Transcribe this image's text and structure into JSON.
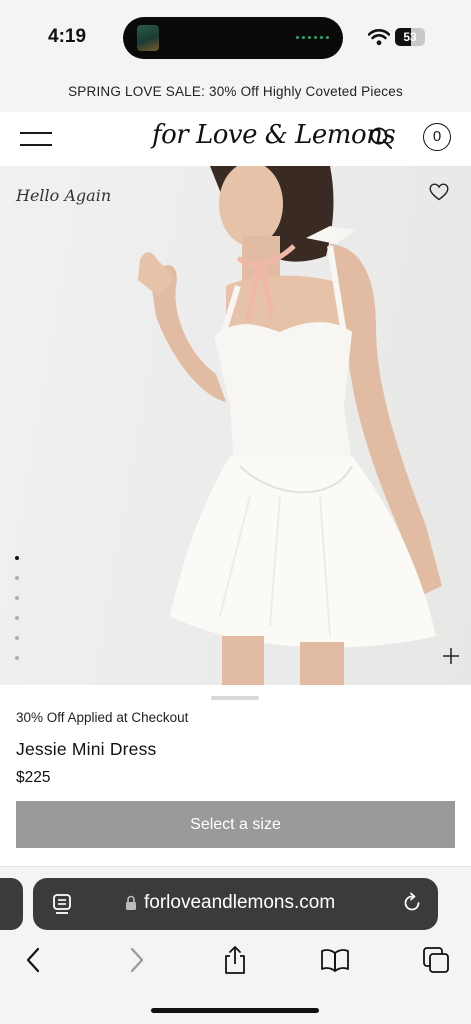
{
  "status_bar": {
    "time": "4:19",
    "battery_level": "53",
    "battery_fraction": 0.53
  },
  "promo_banner": {
    "text": "SPRING LOVE SALE: 30% Off Highly Coveted Pieces"
  },
  "header": {
    "logo_text": "for Love & Lemons",
    "cart_count": "0",
    "icons": [
      "menu-icon",
      "search-icon",
      "cart-icon"
    ]
  },
  "hero": {
    "label": "Hello Again",
    "carousel_count": 6,
    "carousel_active": 1,
    "icons": [
      "heart-icon",
      "plus-icon"
    ]
  },
  "product": {
    "discount_note": "30% Off Applied at Checkout",
    "name": "Jessie Mini Dress",
    "price": "$225",
    "size_button_label": "Select a size"
  },
  "browser": {
    "url": "forloveandlemons.com",
    "toolbar_icons": [
      "back-icon",
      "forward-icon",
      "share-icon",
      "bookmarks-icon",
      "tabs-icon"
    ]
  },
  "colors": {
    "size_button": "#9a9a9a",
    "url_bar": "#3b3b3b",
    "ribbon": "#f0b8a8"
  }
}
